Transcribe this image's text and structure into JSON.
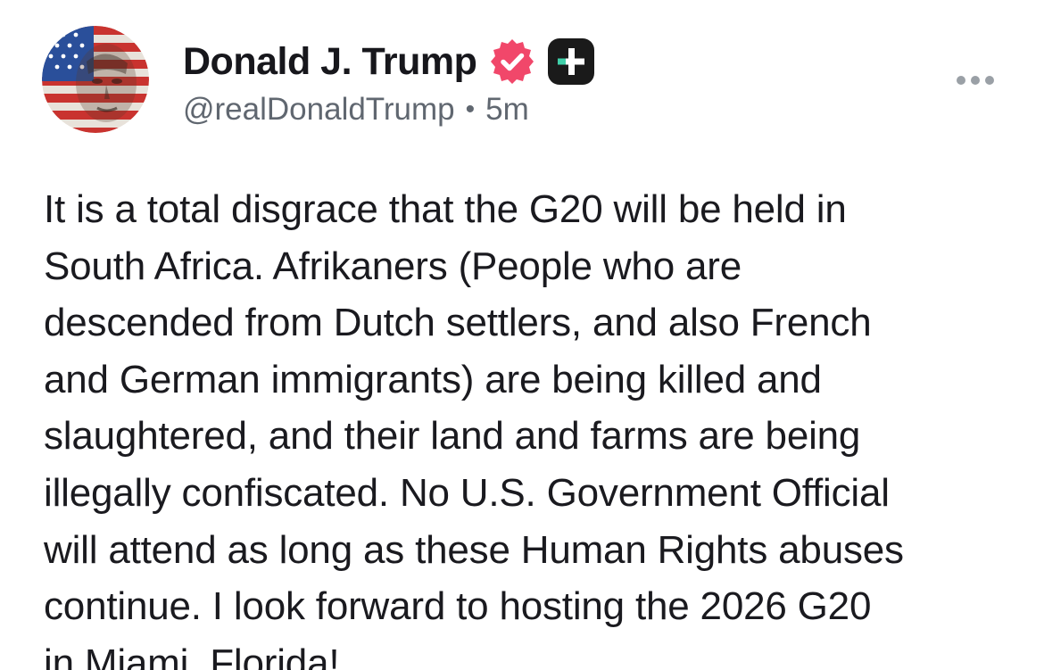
{
  "author": {
    "display_name": "Donald J. Trump",
    "handle": "@realDonaldTrump",
    "timestamp": "5m",
    "separator": "•"
  },
  "icons": {
    "avatar": "avatar-flag-portrait",
    "verified": "verified-badge-icon",
    "plus": "plus-badge-icon",
    "more": "more-options-icon"
  },
  "colors": {
    "verified_badge": "#f1476a",
    "plus_badge": "#1a1a1a",
    "text": "#1a1a1f",
    "meta": "#606770"
  },
  "post": {
    "text": "It is a total disgrace that the G20 will be held in\nSouth Africa. Afrikaners (People who are\ndescended from Dutch settlers, and also French\nand German immigrants) are being killed and\nslaughtered, and their land and farms are being\nillegally confiscated. No U.S. Government Official\nwill attend as long as these Human Rights abuses\ncontinue. I look forward to hosting the 2026 G20\nin Miami, Florida!"
  }
}
